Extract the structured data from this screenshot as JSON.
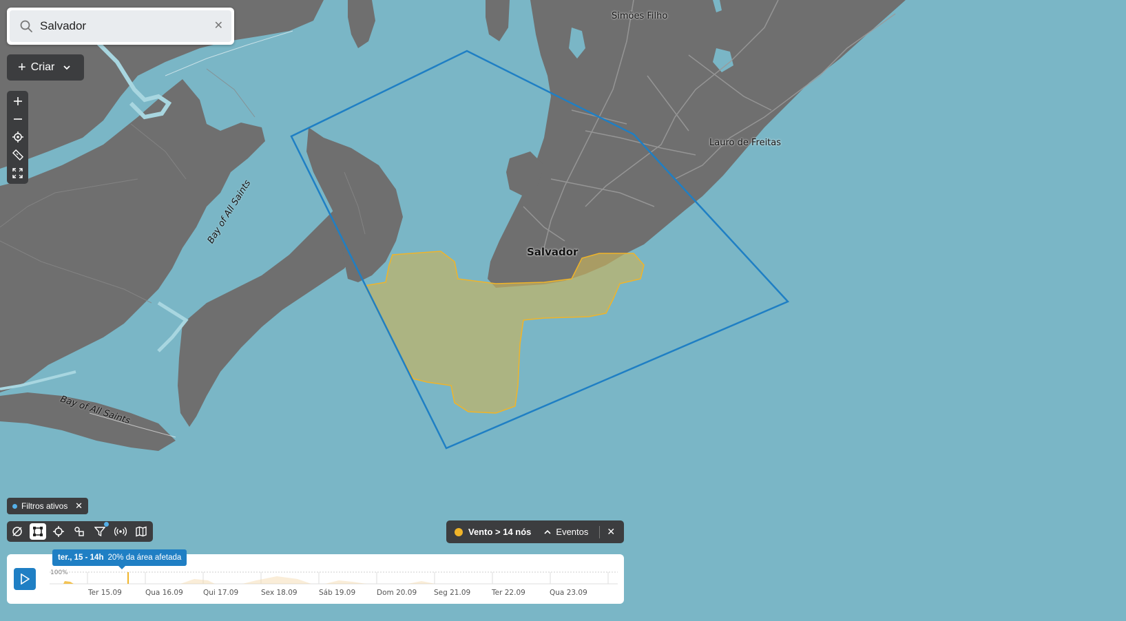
{
  "search": {
    "value": "Salvador",
    "clear_icon": "close-icon"
  },
  "create_button": {
    "label": "Criar",
    "icon": "plus-icon"
  },
  "map_tools": [
    "zoom-in-icon",
    "zoom-out-icon",
    "locate-icon",
    "ruler-icon",
    "fullscreen-icon"
  ],
  "map_labels": {
    "simoes_filho": "Simões Filho",
    "lauro_de_freitas": "Lauro de Freitas",
    "salvador": "Salvador",
    "bay_of_all_saints_1": "Bay of All Saints",
    "bay_of_all_saints_2": "Bay of All Saints"
  },
  "filters_badge": {
    "label": "Filtros ativos"
  },
  "bottom_toolbar": [
    "layers-off-icon",
    "polygon-select-icon",
    "target-icon",
    "shapes-icon",
    "filter-icon",
    "broadcast-icon",
    "map-icon"
  ],
  "event_pill": {
    "title": "Vento > 14 nós",
    "events_label": "Eventos",
    "color": "#f0b429"
  },
  "timeline": {
    "tooltip_date": "ter., 15 - 14h",
    "tooltip_info": "20% da área afetada",
    "percent_label": "100%",
    "days": [
      "Ter 15.09",
      "Qua 16.09",
      "Qui 17.09",
      "Sex 18.09",
      "Sáb 19.09",
      "Dom 20.09",
      "Seg 21.09",
      "Ter 22.09",
      "Qua 23.09"
    ]
  },
  "colors": {
    "water": "#7ab6c6",
    "land": "#6f6f6f",
    "polygon": "#1f7fc4",
    "affected_area": "#f0b429"
  }
}
